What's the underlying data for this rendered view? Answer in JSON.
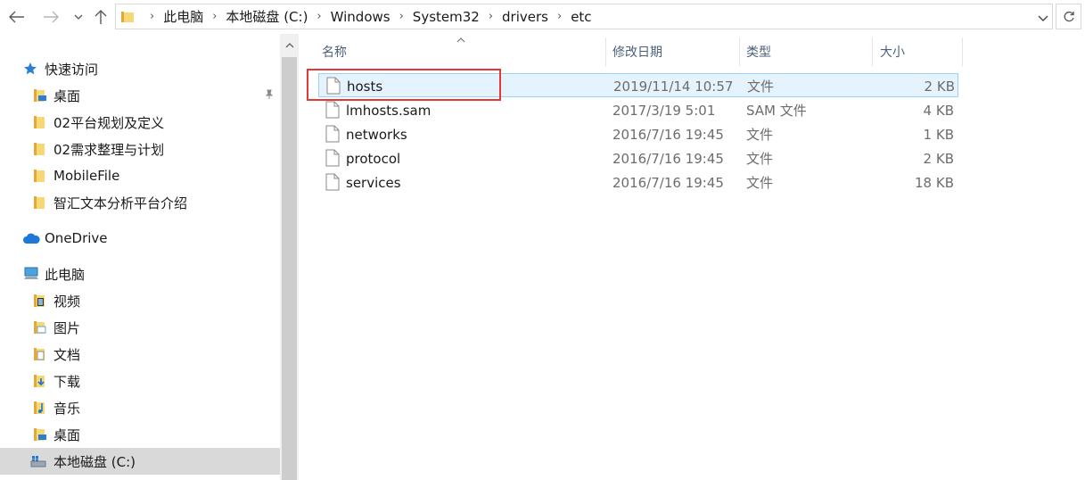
{
  "nav": {
    "address": [
      "此电脑",
      "本地磁盘 (C:)",
      "Windows",
      "System32",
      "drivers",
      "etc"
    ]
  },
  "sidebar": {
    "items": [
      {
        "label": "快速访问",
        "icon": "star-icon"
      },
      {
        "label": "桌面",
        "icon": "desktop-folder-icon",
        "pinned": true
      },
      {
        "label": "02平台规划及定义",
        "icon": "folder-icon"
      },
      {
        "label": "02需求整理与计划",
        "icon": "folder-icon"
      },
      {
        "label": "MobileFile",
        "icon": "folder-icon"
      },
      {
        "label": "智汇文本分析平台介绍",
        "icon": "folder-icon"
      },
      {
        "label": "OneDrive",
        "icon": "cloud-icon"
      },
      {
        "label": "此电脑",
        "icon": "computer-icon"
      },
      {
        "label": "视频",
        "icon": "video-folder-icon"
      },
      {
        "label": "图片",
        "icon": "pictures-folder-icon"
      },
      {
        "label": "文档",
        "icon": "documents-folder-icon"
      },
      {
        "label": "下载",
        "icon": "download-folder-icon"
      },
      {
        "label": "音乐",
        "icon": "music-folder-icon"
      },
      {
        "label": "桌面",
        "icon": "desktop-folder-icon"
      },
      {
        "label": "本地磁盘 (C:)",
        "icon": "drive-icon",
        "selected": true
      }
    ]
  },
  "columns": {
    "name": "名称",
    "date": "修改日期",
    "type": "类型",
    "size": "大小"
  },
  "files": [
    {
      "name": "hosts",
      "date": "2019/11/14 10:57",
      "type": "文件",
      "size": "2 KB"
    },
    {
      "name": "lmhosts.sam",
      "date": "2017/3/19 5:01",
      "type": "SAM 文件",
      "size": "4 KB"
    },
    {
      "name": "networks",
      "date": "2016/7/16 19:45",
      "type": "文件",
      "size": "1 KB"
    },
    {
      "name": "protocol",
      "date": "2016/7/16 19:45",
      "type": "文件",
      "size": "2 KB"
    },
    {
      "name": "services",
      "date": "2016/7/16 19:45",
      "type": "文件",
      "size": "18 KB"
    }
  ],
  "colors": {
    "highlight": "#e53935",
    "selection": "#d9d9d9",
    "hover_border": "#99d1ff",
    "folder": "#f8d775"
  }
}
